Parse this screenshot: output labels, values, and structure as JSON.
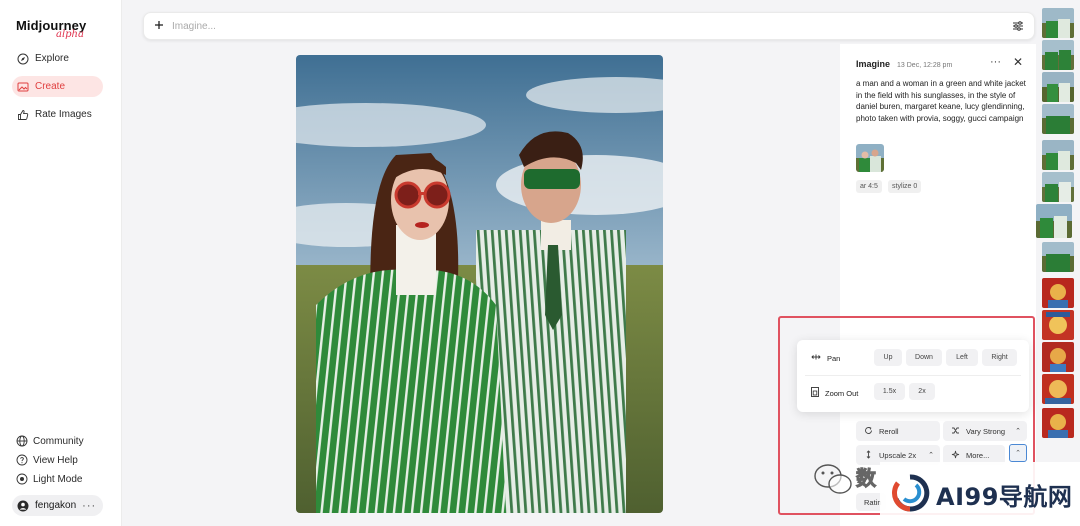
{
  "app": {
    "name": "Midjourney",
    "tag": "alpha"
  },
  "nav": {
    "explore": "Explore",
    "create": "Create",
    "rate": "Rate Images"
  },
  "bottom_nav": {
    "community": "Community",
    "help": "View Help",
    "mode": "Light Mode"
  },
  "user": {
    "name": "fengakon",
    "menu": "···"
  },
  "search": {
    "placeholder": "Imagine..."
  },
  "detail": {
    "title": "Imagine",
    "date": "13 Dec, 12:28 pm",
    "prompt": "a man and a woman in a green and white jacket in the field with his sunglasses, in the style of daniel buren, margaret keane, lucy glendinning, photo taken with provia, soggy, gucci campaign",
    "params": [
      "ar 4:5",
      "stylize 0"
    ]
  },
  "pan": {
    "label": "Pan",
    "buttons": [
      "Up",
      "Down",
      "Left",
      "Right"
    ]
  },
  "zoom": {
    "label": "Zoom Out",
    "buttons": [
      "1.5x",
      "2x"
    ]
  },
  "actions": {
    "reroll": "Reroll",
    "vary": "Vary Strong",
    "upscale": "Upscale 2x",
    "more": "More...",
    "rating": "Ratin"
  },
  "watermark": {
    "site": "AI99导航网",
    "wechat": "数"
  },
  "colors": {
    "accent": "#e04040",
    "highlight_box": "#e05260",
    "active_bg": "#fde5e4",
    "focus": "#4a88d4"
  }
}
